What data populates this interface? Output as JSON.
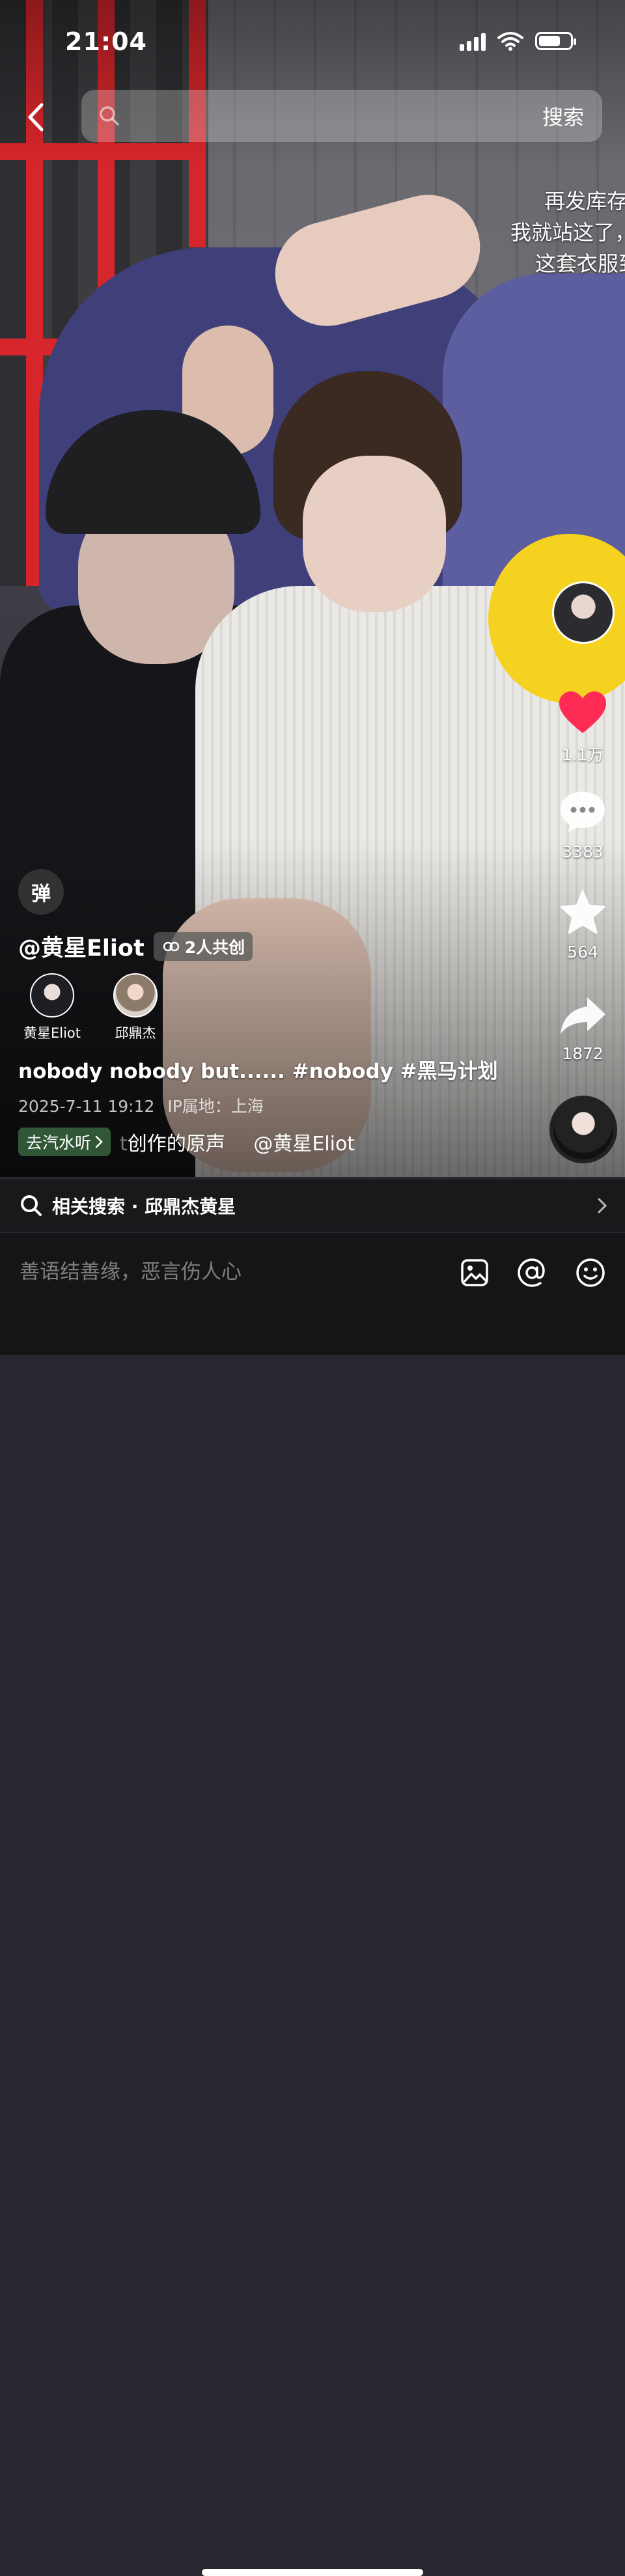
{
  "status_bar": {
    "time": "21:04"
  },
  "search": {
    "placeholder": "",
    "button_label": "搜索"
  },
  "overlay_text": [
    "再发库存话",
    "我就站这了，我",
    "这套衣服到"
  ],
  "actions": {
    "like_count": "1.1万",
    "comment_count": "3383",
    "favorite_count": "564",
    "share_count": "1872"
  },
  "danmaku_label": "弹",
  "video": {
    "author": "@黄星Eliot",
    "cocreate_label": "2人共创",
    "collaborators": [
      {
        "name": "黄星Eliot"
      },
      {
        "name": "邱鼎杰"
      }
    ],
    "description": "nobody nobody but...... #nobody #黑马计划",
    "date": "2025-7-11 19:12",
    "ip_location": "IP属地：上海",
    "music_chip": "去汽水听",
    "music_text_faded": "t",
    "music_text": "创作的原声",
    "music_author": "@黄星Eliot"
  },
  "related_search": {
    "label": "相关搜索 · 邱鼎杰黄星"
  },
  "comment_bar": {
    "placeholder": "善语结善缘，恶言伤人心"
  },
  "colors": {
    "like_red": "#fe2c55",
    "related_bg": "#141416"
  }
}
